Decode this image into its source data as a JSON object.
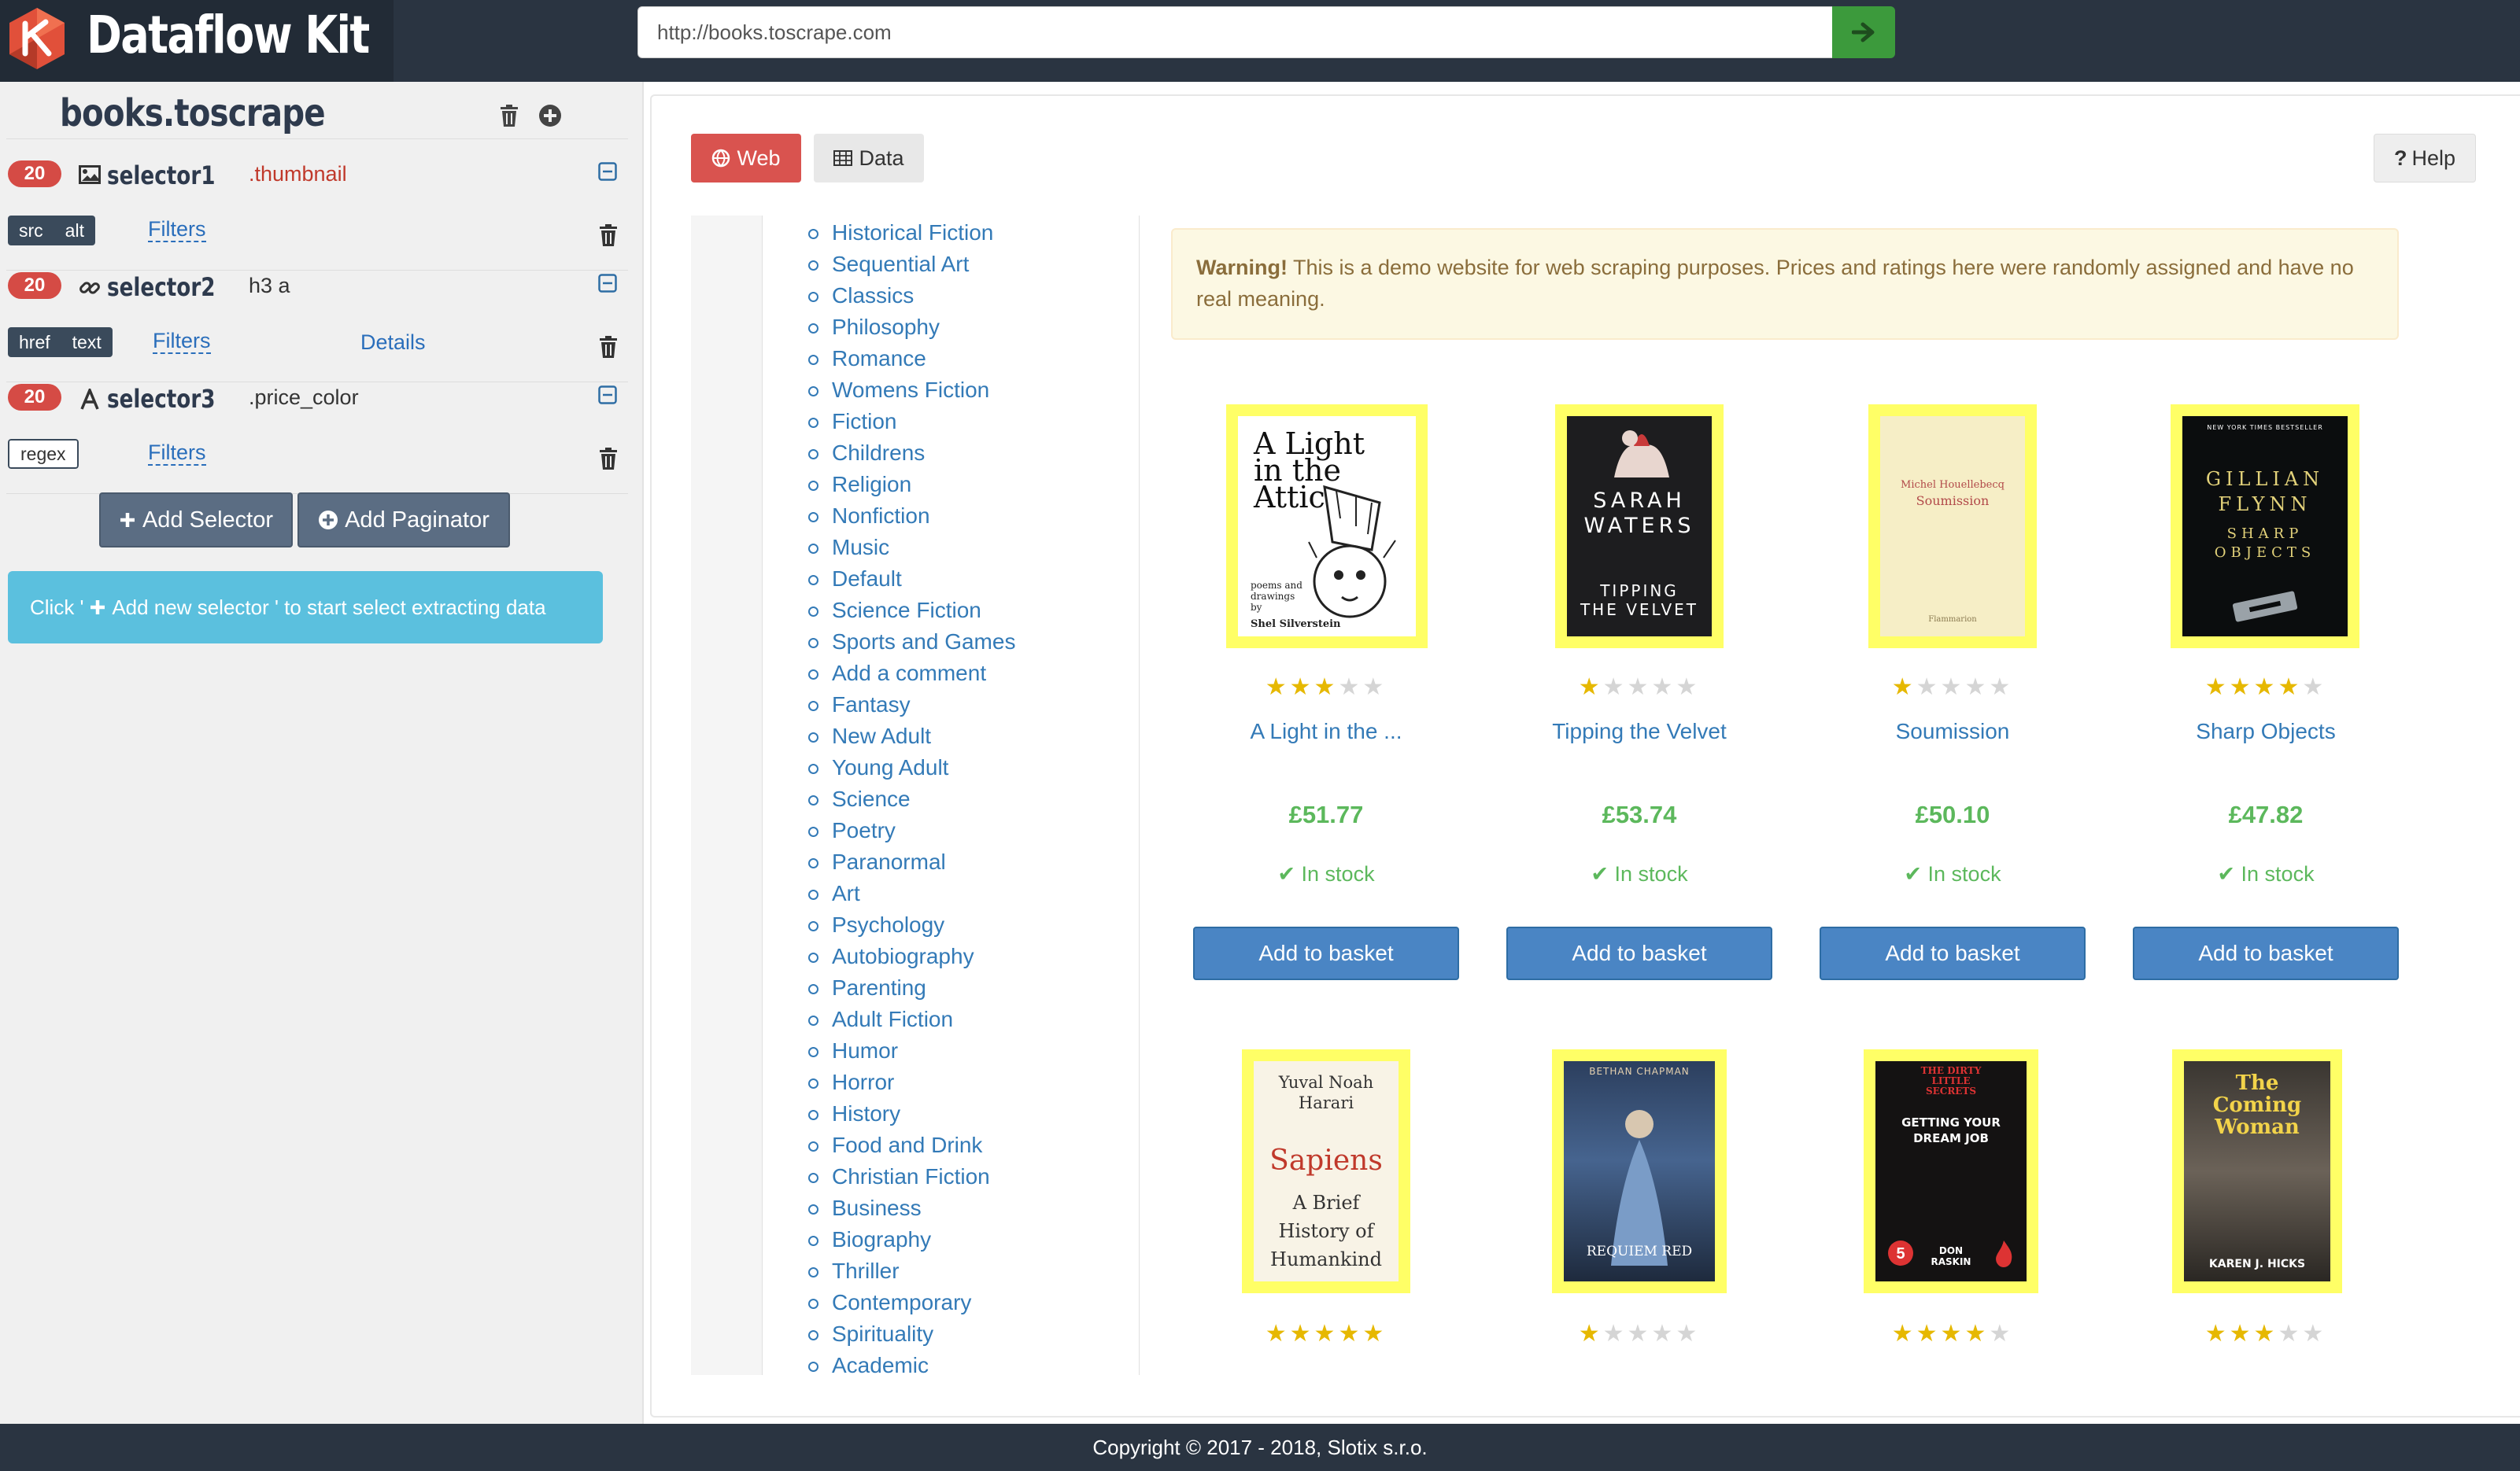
{
  "app": {
    "name": "Dataflow Kit",
    "url": "http://books.toscrape.com"
  },
  "sidebar": {
    "project": "books.toscrape",
    "selectors": [
      {
        "count": "20",
        "icon": "image-icon",
        "name": "selector1",
        "css": ".thumbnail",
        "tags": [
          "src",
          "alt"
        ],
        "filters": "Filters",
        "details": ""
      },
      {
        "count": "20",
        "icon": "link-icon",
        "name": "selector2",
        "css": "h3 a",
        "tags": [
          "href",
          "text"
        ],
        "filters": "Filters",
        "details": "Details"
      },
      {
        "count": "20",
        "icon": "text-icon",
        "name": "selector3",
        "css": ".price_color",
        "tags": [
          "regex"
        ],
        "filters": "Filters",
        "details": ""
      }
    ],
    "add_selector": "Add Selector",
    "add_paginator": "Add Paginator",
    "info_pre": "Click '",
    "info_post": " Add new selector ' to start select extracting data"
  },
  "toolbar": {
    "web_tab": "Web",
    "data_tab": "Data",
    "help": "Help"
  },
  "site": {
    "categories": [
      "Historical Fiction",
      "Sequential Art",
      "Classics",
      "Philosophy",
      "Romance",
      "Womens Fiction",
      "Fiction",
      "Childrens",
      "Religion",
      "Nonfiction",
      "Music",
      "Default",
      "Science Fiction",
      "Sports and Games",
      "Add a comment",
      "Fantasy",
      "New Adult",
      "Young Adult",
      "Science",
      "Poetry",
      "Paranormal",
      "Art",
      "Psychology",
      "Autobiography",
      "Parenting",
      "Adult Fiction",
      "Humor",
      "Horror",
      "History",
      "Food and Drink",
      "Christian Fiction",
      "Business",
      "Biography",
      "Thriller",
      "Contemporary",
      "Spirituality",
      "Academic"
    ],
    "warning_bold": "Warning!",
    "warning_text": " This is a demo website for web scraping purposes. Prices and ratings here were randomly assigned and have no real meaning.",
    "books": [
      {
        "title": "A Light in the ...",
        "rating": 3,
        "price": "£51.77",
        "stock": "In stock",
        "button": "Add to basket",
        "cover": {
          "line1": "A Light",
          "line2": "in the",
          "line3": "Attic",
          "note": "poems and drawings by",
          "author": "Shel Silverstein"
        }
      },
      {
        "title": "Tipping the Velvet",
        "rating": 1,
        "price": "£53.74",
        "stock": "In stock",
        "button": "Add to basket",
        "cover": {
          "line1": "SARAH",
          "line2": "WATERS",
          "line3": "TIPPING",
          "line4": "THE VELVET"
        }
      },
      {
        "title": "Soumission",
        "rating": 1,
        "price": "£50.10",
        "stock": "In stock",
        "button": "Add to basket",
        "cover": {
          "author": "Michel Houellebecq",
          "line1": "Soumission",
          "publisher": "Flammarion"
        }
      },
      {
        "title": "Sharp Objects",
        "rating": 4,
        "price": "£47.82",
        "stock": "In stock",
        "button": "Add to basket",
        "cover": {
          "top": "NEW YORK TIMES BESTSELLER",
          "line1": "GILLIAN",
          "line2": "FLYNN",
          "line3": "SHARP",
          "line4": "OBJECTS"
        }
      }
    ],
    "books_row2": [
      {
        "rating": 5,
        "cover": {
          "author1": "Yuval Noah",
          "author2": "Harari",
          "line1": "Sapiens",
          "line2": "A Brief",
          "line3": "History of",
          "line4": "Humankind"
        }
      },
      {
        "rating": 1,
        "cover": {
          "author": "BETHAN CHAPMAN",
          "line1": "REQUIEM RED"
        }
      },
      {
        "rating": 4,
        "cover": {
          "top1": "THE DIRTY",
          "top2": "LITTLE",
          "top3": "SECRETS",
          "line1": "GETTING YOUR",
          "line2": "DREAM JOB",
          "author1": "DON",
          "author2": "RASKIN"
        }
      },
      {
        "rating": 3,
        "cover": {
          "line1": "The",
          "line2": "Coming",
          "line3": "Woman",
          "author": "KAREN J. HICKS"
        }
      }
    ]
  },
  "footer": "Copyright © 2017 - 2018, Slotix s.r.o.",
  "colors": {
    "topbar": "#2a3441",
    "danger": "#d54b45",
    "info": "#5bc0de",
    "primary": "#4a85c4",
    "success": "#5cb85c",
    "link": "#337ab7"
  }
}
